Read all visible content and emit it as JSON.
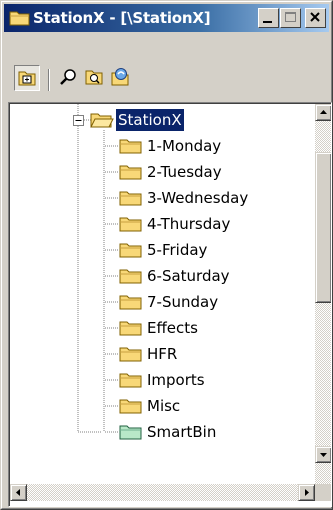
{
  "window": {
    "title": "StationX - [\\StationX]"
  },
  "toolbar": {
    "items": [
      {
        "name": "expand-tree-icon",
        "pressed": true
      },
      {
        "name": "find-icon",
        "pressed": false
      },
      {
        "name": "find-folder-icon",
        "pressed": false
      },
      {
        "name": "refresh-folder-icon",
        "pressed": false
      }
    ]
  },
  "tree": {
    "root": {
      "label": "StationX",
      "expanded": true,
      "selected": true
    },
    "children": [
      {
        "label": "1-Monday",
        "icon": "folder-icon"
      },
      {
        "label": "2-Tuesday",
        "icon": "folder-icon"
      },
      {
        "label": "3-Wednesday",
        "icon": "folder-icon"
      },
      {
        "label": "4-Thursday",
        "icon": "folder-icon"
      },
      {
        "label": "5-Friday",
        "icon": "folder-icon"
      },
      {
        "label": "6-Saturday",
        "icon": "folder-icon"
      },
      {
        "label": "7-Sunday",
        "icon": "folder-icon"
      },
      {
        "label": "Effects",
        "icon": "folder-icon"
      },
      {
        "label": "HFR",
        "icon": "folder-icon"
      },
      {
        "label": "Imports",
        "icon": "folder-icon"
      },
      {
        "label": "Misc",
        "icon": "folder-icon"
      },
      {
        "label": "SmartBin",
        "icon": "smart-folder-icon"
      }
    ]
  },
  "colors": {
    "titlebar_start": "#0a246a",
    "titlebar_end": "#a6caf0",
    "selection": "#0a246a",
    "folder": "#f8d878",
    "smart_folder": "#b8e8c8"
  }
}
